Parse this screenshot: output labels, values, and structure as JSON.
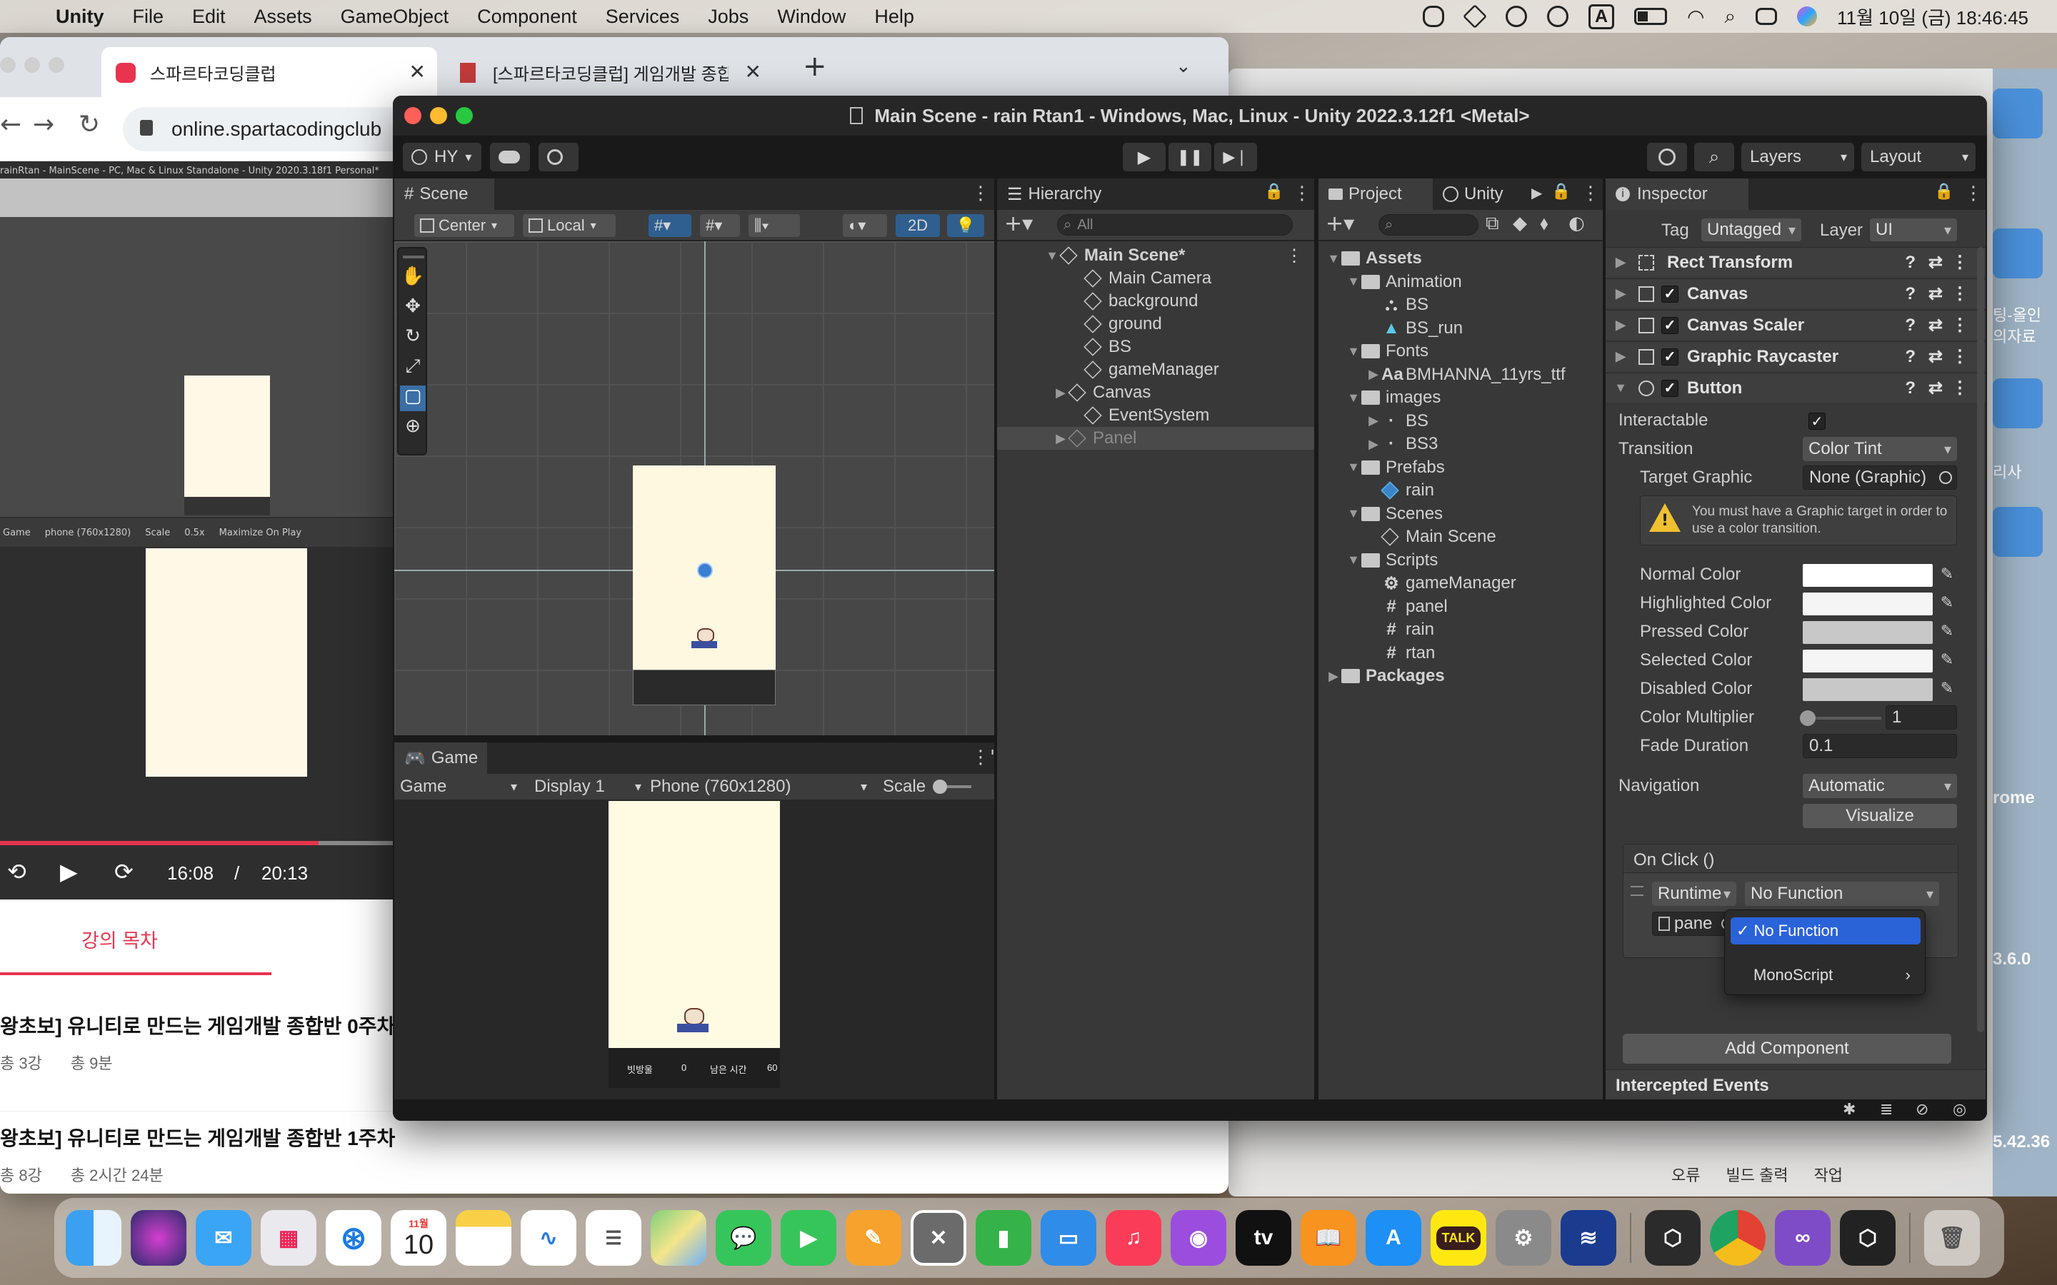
{
  "menubar": {
    "app": "Unity",
    "items": [
      "File",
      "Edit",
      "Assets",
      "GameObject",
      "Component",
      "Services",
      "Jobs",
      "Window",
      "Help"
    ],
    "input_badge": "A",
    "clock": "11월 10일 (금) 18:46:45"
  },
  "browser": {
    "tab1": "스파르타코딩클럽",
    "tab2": "[스파르타코딩클럽] 게임개발 종합반",
    "url": "online.spartacodingclub",
    "video_current": "16:08",
    "video_sep": "/",
    "video_total": "20:13",
    "lecture_tab": "강의 목차",
    "lecture1": "왕초보] 유니티로 만드는 게임개발 종합반 0주차",
    "lecture1_count": "총 3강",
    "lecture1_time": "총 9분",
    "lecture2": "왕초보] 유니티로 만드는 게임개발 종합반 1주차",
    "lecture2_count": "총 8강",
    "lecture2_time": "총 2시간 24분",
    "video_scene_header": "rainRtan - MainScene - PC, Mac & Linux Standalone - Unity 2020.3.18f1 Personal*",
    "video_game_tab": "Game",
    "video_display": "phone (760x1280)",
    "video_scale": "Scale",
    "video_scale_val": "0.5x",
    "video_maximize": "Maximize On Play"
  },
  "right_bg": {
    "l1": "팅-올인",
    "l2": "의자료",
    "l3": "리사",
    "l4": "rome",
    "l5": "3.6.0",
    "l6": "5.42.36",
    "err": "오류",
    "build": "빌드 출력",
    "work": "작업"
  },
  "unity": {
    "title": "Main Scene - rain Rtan1 - Windows, Mac, Linux - Unity 2022.3.12f1 <Metal>",
    "account": "HY",
    "layers": "Layers",
    "layout": "Layout",
    "scene": {
      "tab": "Scene",
      "pivot": "Center",
      "space": "Local",
      "mode2d": "2D"
    },
    "game": {
      "tab": "Game",
      "view": "Game",
      "display": "Display 1",
      "resolution": "Phone (760x1280)",
      "scale": "Scale",
      "hud_label1": "빗방울",
      "hud_val1": "0",
      "hud_label2": "남은 시간",
      "hud_val2": "60"
    },
    "hierarchy": {
      "tab": "Hierarchy",
      "search": "All",
      "scene": "Main Scene*",
      "items": [
        "Main Camera",
        "background",
        "ground",
        "BS",
        "gameManager",
        "Canvas",
        "EventSystem",
        "Panel"
      ]
    },
    "project": {
      "tab": "Project",
      "tab2": "Unity",
      "tree": [
        {
          "label": "Assets",
          "kind": "folder",
          "bold": true
        },
        {
          "label": "Animation",
          "kind": "folder"
        },
        {
          "label": "BS",
          "kind": "anim"
        },
        {
          "label": "BS_run",
          "kind": "clip"
        },
        {
          "label": "Fonts",
          "kind": "folder"
        },
        {
          "label": "BMHANNA_11yrs_ttf",
          "kind": "font"
        },
        {
          "label": "images",
          "kind": "folder"
        },
        {
          "label": "BS",
          "kind": "sprite"
        },
        {
          "label": "BS3",
          "kind": "sprite"
        },
        {
          "label": "Prefabs",
          "kind": "folder"
        },
        {
          "label": "rain",
          "kind": "prefab"
        },
        {
          "label": "Scenes",
          "kind": "folder"
        },
        {
          "label": "Main Scene",
          "kind": "scene"
        },
        {
          "label": "Scripts",
          "kind": "folder"
        },
        {
          "label": "gameManager",
          "kind": "gear"
        },
        {
          "label": "panel",
          "kind": "script"
        },
        {
          "label": "rain",
          "kind": "script"
        },
        {
          "label": "rtan",
          "kind": "script"
        },
        {
          "label": "Packages",
          "kind": "folder",
          "bold": true
        }
      ],
      "font_prefix": "Aa",
      "script_prefix": "#"
    },
    "inspector": {
      "tab": "Inspector",
      "tag_label": "Tag",
      "tag_value": "Untagged",
      "layer_label": "Layer",
      "layer_value": "UI",
      "components": [
        "Rect Transform",
        "Canvas",
        "Canvas Scaler",
        "Graphic Raycaster",
        "Button"
      ],
      "interactable": "Interactable",
      "transition": "Transition",
      "transition_value": "Color Tint",
      "target_graphic": "Target Graphic",
      "target_graphic_value": "None (Graphic)",
      "warning": "You must have a Graphic target in order to use a color transition.",
      "normal_color": "Normal Color",
      "highlighted_color": "Highlighted Color",
      "pressed_color": "Pressed Color",
      "selected_color": "Selected Color",
      "disabled_color": "Disabled Color",
      "color_multiplier": "Color Multiplier",
      "color_multiplier_value": "1",
      "fade_duration": "Fade Duration",
      "fade_duration_value": "0.1",
      "navigation": "Navigation",
      "navigation_value": "Automatic",
      "visualize": "Visualize",
      "onclick": "On Click ()",
      "runtime": "Runtime",
      "nofunction": "No Function",
      "object_ref": "pane",
      "menu_nofunction": "No Function",
      "menu_monoscript": "MonoScript",
      "add_component": "Add Component",
      "intercepted": "Intercepted Events",
      "colors": {
        "normal": "#ffffff",
        "highlighted": "#f5f5f5",
        "pressed": "#c8c8c8",
        "selected": "#f5f5f5",
        "disabled": "#c8c8c8"
      }
    }
  },
  "dock": {
    "calendar_month": "11월",
    "calendar_day": "10",
    "tv": "tv",
    "talk": "TALK"
  }
}
